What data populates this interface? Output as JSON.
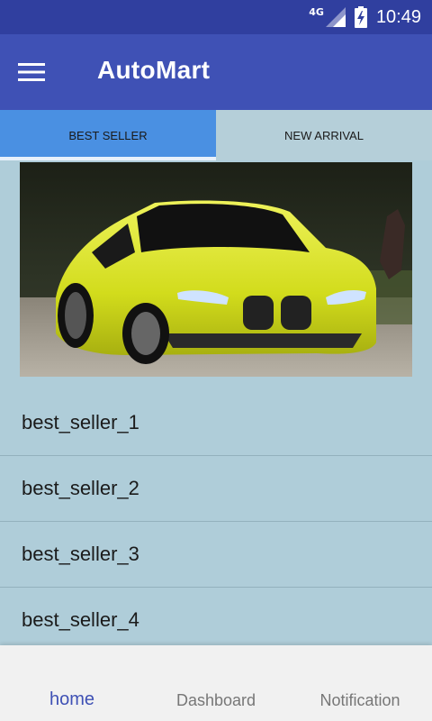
{
  "status_bar": {
    "network": "4G",
    "time": "10:49"
  },
  "app_bar": {
    "title": "AutoMart",
    "menu_icon": "menu-icon"
  },
  "tabs": [
    {
      "label": "BEST SELLER",
      "active": true
    },
    {
      "label": "NEW ARRIVAL",
      "active": false
    }
  ],
  "banner": {
    "image": "car-photo"
  },
  "list": [
    {
      "label": "best_seller_1"
    },
    {
      "label": "best_seller_2"
    },
    {
      "label": "best_seller_3"
    },
    {
      "label": "best_seller_4"
    }
  ],
  "bottom_nav": [
    {
      "label": "home",
      "active": true
    },
    {
      "label": "Dashboard",
      "active": false
    },
    {
      "label": "Notification",
      "active": false
    }
  ],
  "colors": {
    "primary": "#3f51b5",
    "primary_dark": "#303f9f",
    "tab_active": "#4a90e2",
    "background": "#afcdd9"
  }
}
